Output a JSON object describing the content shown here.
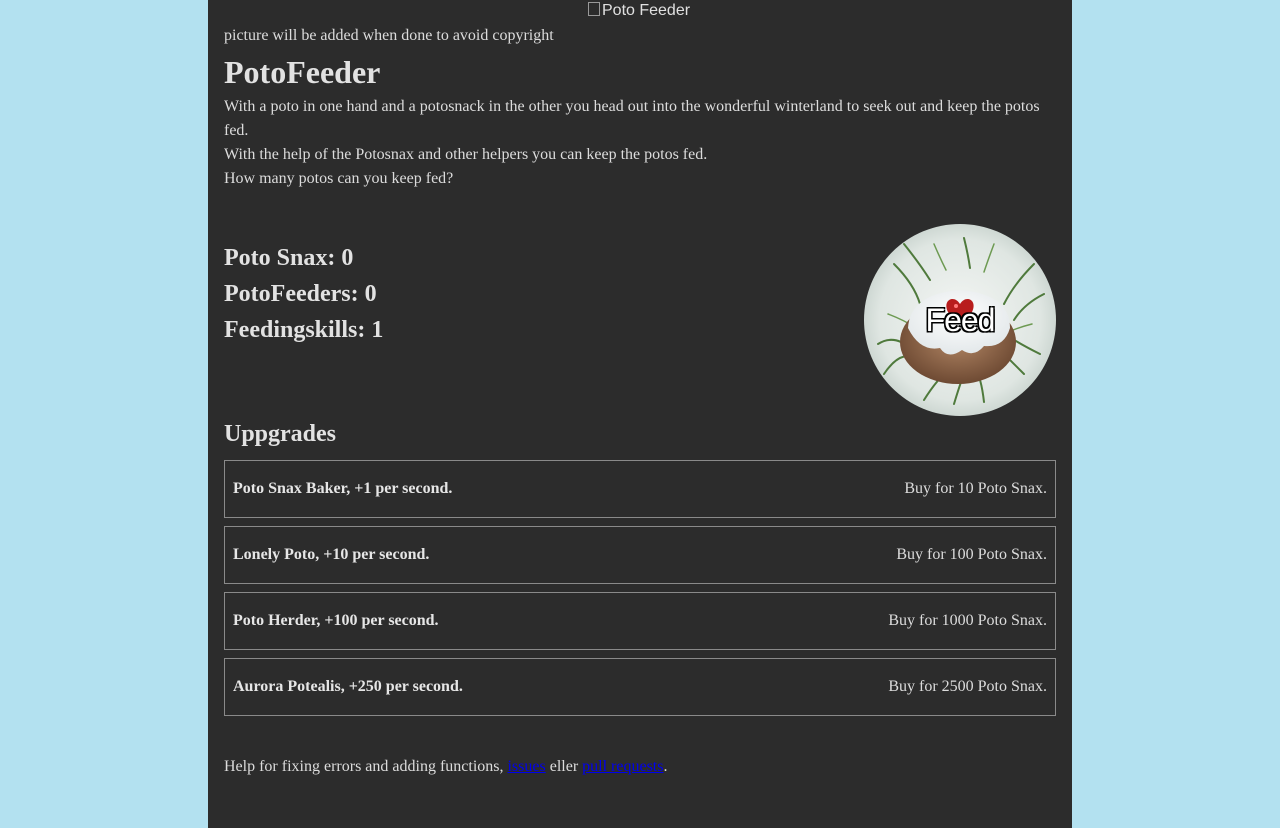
{
  "banner": {
    "alt_text": "Poto Feeder"
  },
  "note": "picture will be added when done to avoid copyright",
  "title": "PotoFeeder",
  "intro": [
    "With a poto in one hand and a potosnack in the other you head out into the wonderful winterland to seek out and keep the potos fed.",
    "With the help of the Potosnax and other helpers you can keep the potos fed.",
    "How many potos can you keep fed?"
  ],
  "stats": {
    "snax": "Poto Snax: 0",
    "feeders": "PotoFeeders: 0",
    "skills": "Feedingskills: 1"
  },
  "feed_button": {
    "label": "Feed"
  },
  "upgrades_title": "Uppgrades",
  "upgrades": [
    {
      "name": "Poto Snax Baker, +1 per second.",
      "price": "Buy for 10 Poto Snax."
    },
    {
      "name": "Lonely Poto, +10 per second.",
      "price": "Buy for 100 Poto Snax."
    },
    {
      "name": "Poto Herder, +100 per second.",
      "price": "Buy for 1000 Poto Snax."
    },
    {
      "name": "Aurora Potealis, +250 per second.",
      "price": "Buy for 2500 Poto Snax."
    }
  ],
  "footer": {
    "text_before": "Help for fixing errors and adding functions, ",
    "link_issues": "issues",
    "text_mid": " eller ",
    "link_pulls": "pull requests",
    "text_after": "."
  },
  "colors": {
    "page_bg": "#2c2c2c",
    "outer_bg": "#b3e1f0",
    "link": "#0000ee"
  }
}
